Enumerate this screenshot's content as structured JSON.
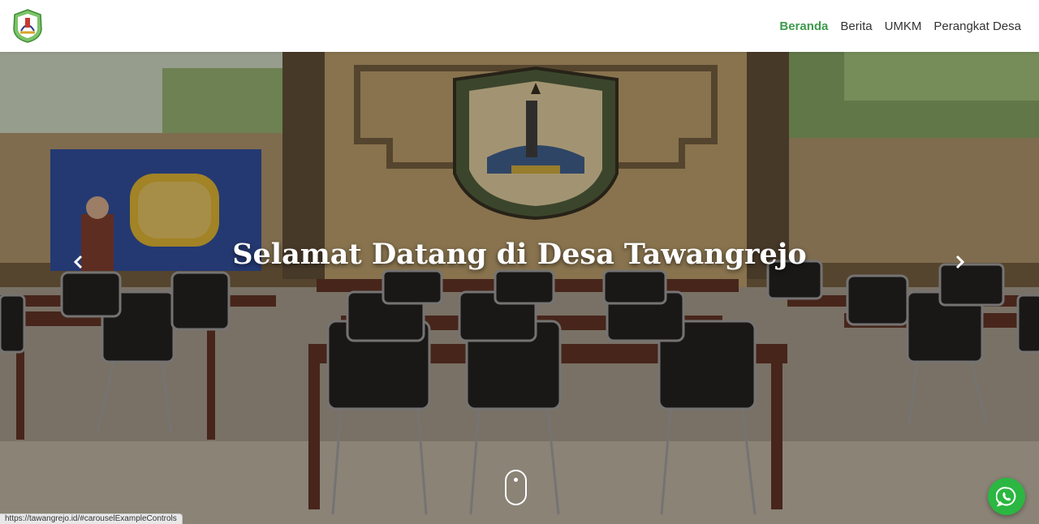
{
  "header": {
    "logo_icon": "village-emblem-logo",
    "nav": [
      {
        "label": "Beranda",
        "active": true
      },
      {
        "label": "Berita",
        "active": false
      },
      {
        "label": "UMKM",
        "active": false
      },
      {
        "label": "Perangkat Desa",
        "active": false
      }
    ],
    "active_color": "#3e9a4d"
  },
  "hero": {
    "title": "Selamat Datang di Desa Tawangrejo",
    "image_description_icon": "meeting-hall-photo",
    "prev_icon": "chevron-left-icon",
    "next_icon": "chevron-right-icon",
    "scroll_icon": "mouse-scroll-icon"
  },
  "whatsapp": {
    "icon": "whatsapp-icon",
    "color": "#2bb741"
  },
  "status_bar": {
    "url": "https://tawangrejo.id/#carouselExampleControls"
  }
}
